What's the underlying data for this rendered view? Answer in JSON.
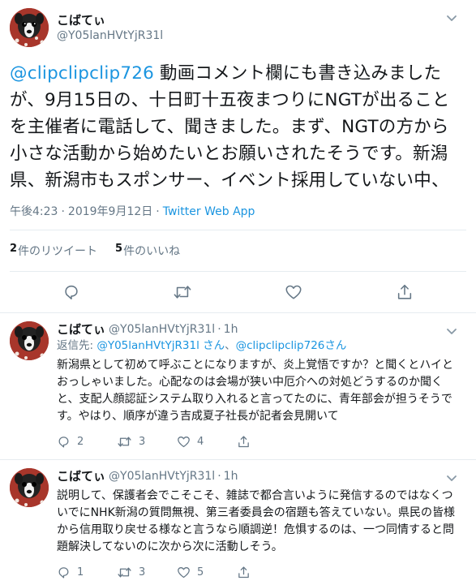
{
  "main_tweet": {
    "user": {
      "display_name": "こばてぃ",
      "handle": "@Y05lanHVtYjR31l",
      "avatar_icon": "dog-avatar-icon"
    },
    "mention": "@clipclipclip726",
    "text": " 動画コメント欄にも書き込みましたが、9月15日の、十日町十五夜まつりにNGTが出ることを主催者に電話して、聞きました。まず、NGTの方から小さな活動から始めたいとお願いされたそうです。新潟県、新潟市もスポンサー、イベント採用していない中、",
    "time": "午後4:23",
    "date": "2019年9月12日",
    "source": "Twitter Web App",
    "retweet_count": "2",
    "retweet_label": "件のリツイート",
    "like_count": "5",
    "like_label": "件のいいね",
    "actions": [
      "reply-icon",
      "retweet-icon",
      "like-icon",
      "share-icon"
    ]
  },
  "replies": [
    {
      "display_name": "こばてぃ",
      "handle": "@Y05lanHVtYjR31l",
      "time": "1h",
      "reply_prefix": "返信先: ",
      "reply_mention_1": "@Y05lanHVtYjR31l さん",
      "reply_sep": "、",
      "reply_mention_2": "@clipclipclip726さん",
      "text": "新潟県として初めて呼ぶことになりますが、炎上覚悟ですか？と聞くとハイとおっしゃいました。心配なのは会場が狭い中厄介への対処どうするのか聞くと、支配人顔認証システム取り入れると言ってたのに、青年部会が担うそうです。やはり、順序が違う吉成夏子社長が記者会見開いて",
      "reply_count": "2",
      "retweet_count": "3",
      "like_count": "4"
    },
    {
      "display_name": "こばてぃ",
      "handle": "@Y05lanHVtYjR31l",
      "time": "1h",
      "text": "説明して、保護者会でこそこそ、雑誌で都合言いように発信するのではなくついでにNHK新潟の質問無視、第三者委員会の宿題も答えていない。県民の皆様から信用取り戻せる様なと言うなら順調逆！危惧するのは、一つ同情すると問題解決してないのに次から次に活動しそう。",
      "reply_count": "1",
      "retweet_count": "3",
      "like_count": "5"
    }
  ],
  "colors": {
    "accent": "#1b95e0",
    "text": "#14171a",
    "muted": "#657786",
    "divider": "#e6ecf0"
  }
}
